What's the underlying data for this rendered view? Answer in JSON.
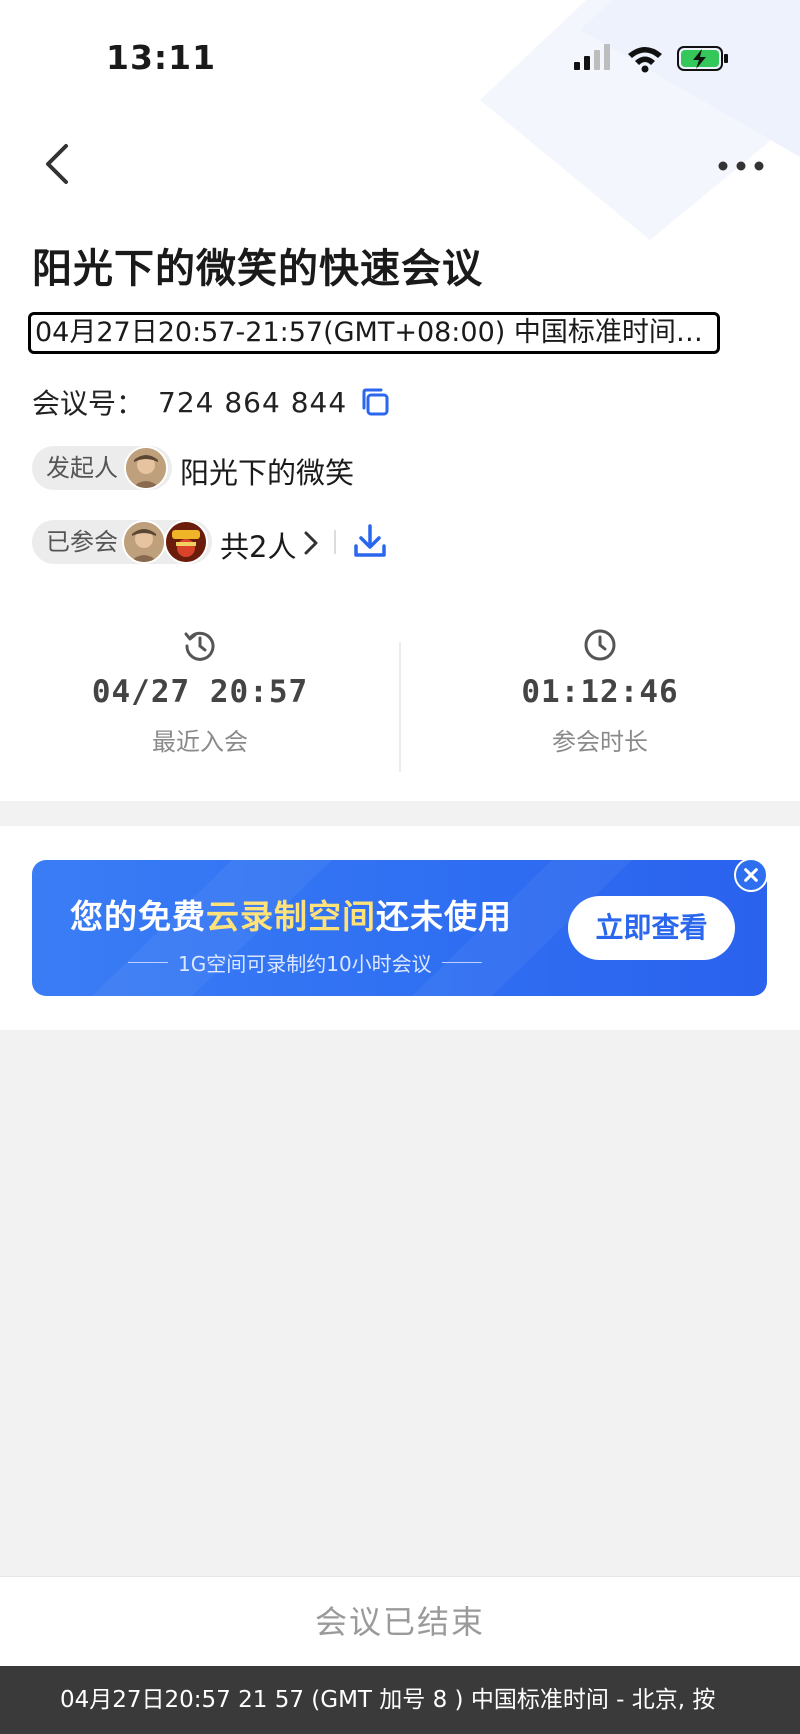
{
  "status_bar": {
    "time": "13:11"
  },
  "meeting": {
    "title": "阳光下的微笑的快速会议",
    "time_range": "04月27日20:57-21:57(GMT+08:00) 中国标准时间…",
    "number_label": "会议号：",
    "number": "724 864 844",
    "host_label": "发起人",
    "host_name": "阳光下的微笑",
    "joined_label": "已参会",
    "joined_count": "共2人"
  },
  "stats": {
    "recent_join": {
      "value": "04/27 20:57",
      "label": "最近入会"
    },
    "duration": {
      "value": "01:12:46",
      "label": "参会时长"
    }
  },
  "promo": {
    "headline_pre": "您的免费",
    "headline_highlight": "云录制空间",
    "headline_post": "还未使用",
    "subtitle": "1G空间可录制约10小时会议",
    "button": "立即查看"
  },
  "footer": {
    "status": "会议已结束"
  },
  "caption": "04月27日20:57  21 57 (GMT 加号  8  ) 中国标准时间 - 北京, 按",
  "colors": {
    "accent": "#2a66ee",
    "highlight": "#ffe27a",
    "battery": "#34c759"
  },
  "icons": [
    "back-icon",
    "more-icon",
    "copy-icon",
    "chevron-right-icon",
    "download-icon",
    "history-icon",
    "clock-icon",
    "close-icon",
    "signal-icon",
    "wifi-icon",
    "battery-icon"
  ]
}
